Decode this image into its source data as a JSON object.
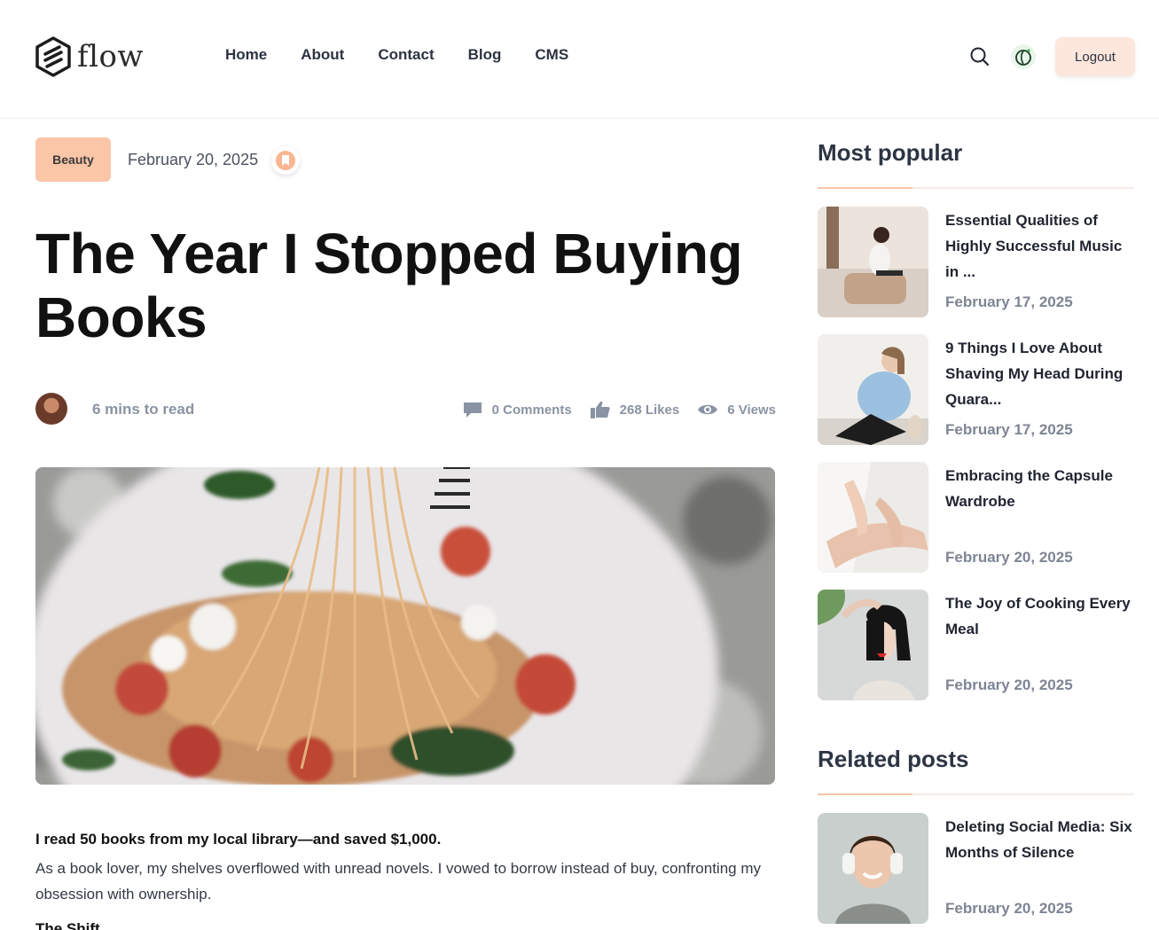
{
  "brand": {
    "name": "flow"
  },
  "nav": {
    "items": [
      "Home",
      "About",
      "Contact",
      "Blog",
      "CMS"
    ]
  },
  "header": {
    "logout_label": "Logout"
  },
  "post": {
    "category": "Beauty",
    "date": "February 20, 2025",
    "title": "The Year I Stopped Buying Books",
    "read_time": "6 mins to read",
    "comments": "0 Comments",
    "likes": "268 Likes",
    "views": "6 Views",
    "lead": "I read 50 books from my local library—and saved $1,000.",
    "body": "As a book lover, my shelves overflowed with unread novels. I vowed to borrow instead of buy, confronting my obsession with ownership.",
    "subheading": "The Shift"
  },
  "sidebar": {
    "popular_heading": "Most popular",
    "popular": [
      {
        "title": "Essential Qualities of Highly Successful Music in ...",
        "date": "February 17, 2025"
      },
      {
        "title": "9 Things I Love About Shaving My Head During Quara...",
        "date": "February 17, 2025"
      },
      {
        "title": "Embracing the Capsule Wardrobe",
        "date": "February 20, 2025"
      },
      {
        "title": "The Joy of Cooking Every Meal",
        "date": "February 20, 2025"
      }
    ],
    "related_heading": "Related posts",
    "related": [
      {
        "title": "Deleting Social Media: Six Months of Silence",
        "date": "February 20, 2025"
      }
    ]
  },
  "colors": {
    "accent": "#fbc6a8",
    "logout_bg": "#fde6dc",
    "muted_text": "#8a93a3"
  }
}
